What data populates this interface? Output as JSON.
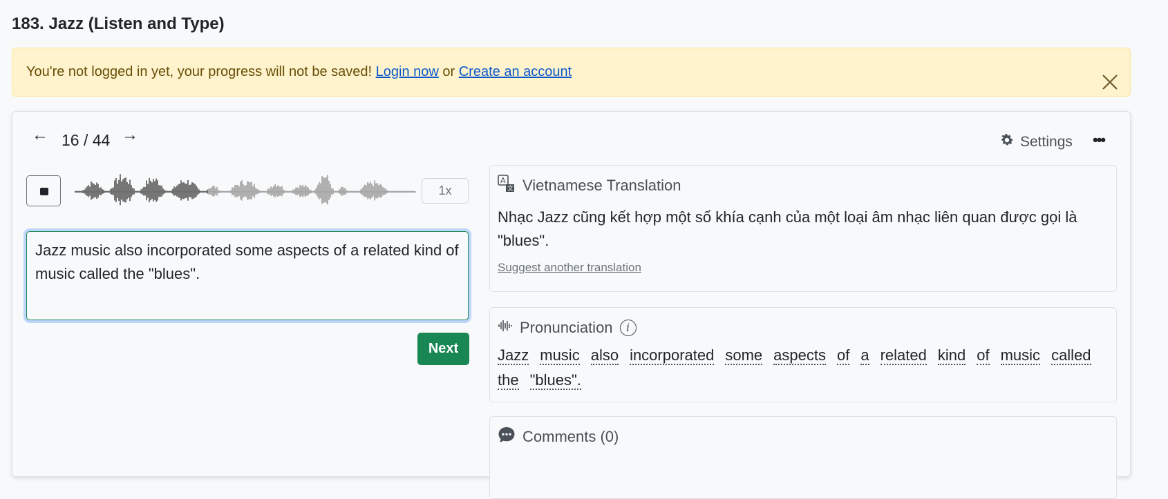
{
  "page": {
    "title": "183. Jazz (Listen and Type)"
  },
  "alert": {
    "message": "You're not logged in yet, your progress will not be saved!",
    "login_link": "Login now",
    "separator": "or",
    "create_link": "Create an account",
    "close_icon": "close-icon"
  },
  "player": {
    "counter": "16 / 44",
    "prev_icon": "arrow-left-icon",
    "next_icon": "arrow-right-icon",
    "settings_label": "Settings",
    "more_label": "•••",
    "stop_icon": "stop-icon",
    "speed_label": "1x",
    "answer_text": "Jazz music also incorporated some aspects of a related kind of music called the \"blues\".",
    "next_button": "Next"
  },
  "translation": {
    "header": "Vietnamese Translation",
    "text": "Nhạc Jazz cũng kết hợp một số khía cạnh của một loại âm nhạc liên quan được gọi là \"blues\".",
    "suggest_link": "Suggest another translation"
  },
  "pronunciation": {
    "header": "Pronunciation",
    "words": [
      "Jazz",
      "music",
      "also",
      "incorporated",
      "some",
      "aspects",
      "of",
      "a",
      "related",
      "kind",
      "of",
      "music",
      "called",
      "the",
      "\"blues\"."
    ]
  },
  "comments": {
    "header": "Comments (0)"
  },
  "colors": {
    "alert_bg": "#fff3cd",
    "alert_text": "#664d03",
    "link": "#0a58ca",
    "next_button": "#198754",
    "waveform_played": "#555555",
    "waveform_unplayed": "#9e9e9e"
  },
  "progress": {
    "audio_played_fraction": 0.39
  }
}
